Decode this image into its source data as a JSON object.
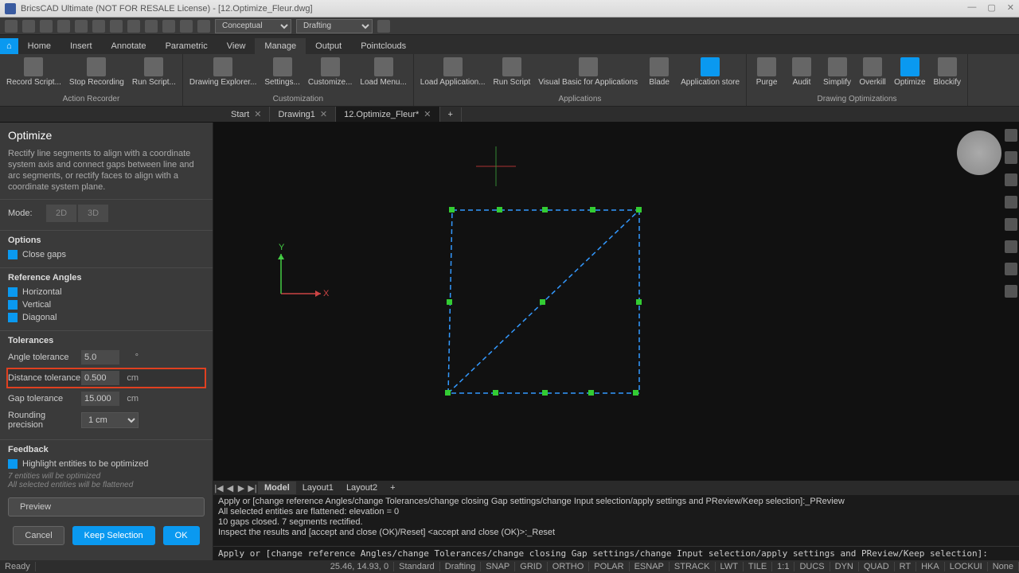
{
  "title": "BricsCAD Ultimate (NOT FOR RESALE License) - [12.Optimize_Fleur.dwg]",
  "qat": {
    "style": "Conceptual",
    "workspace": "Drafting"
  },
  "ribbon_tabs": [
    "Home",
    "Insert",
    "Annotate",
    "Parametric",
    "View",
    "Manage",
    "Output",
    "Pointclouds"
  ],
  "ribbon_active": "Manage",
  "ribbon": {
    "groups": [
      {
        "title": "Action Recorder",
        "items": [
          "Record Script...",
          "Stop Recording",
          "Run Script..."
        ]
      },
      {
        "title": "Customization",
        "items": [
          "Drawing Explorer...",
          "Settings...",
          "Customize...",
          "Load Menu..."
        ]
      },
      {
        "title": "Applications",
        "items": [
          "Load Application...",
          "Run Script",
          "Visual Basic for Applications",
          "Blade",
          "Application store"
        ]
      },
      {
        "title": "Drawing Optimizations",
        "items": [
          "Purge",
          "Audit",
          "Simplify",
          "Overkill",
          "Optimize",
          "Blockify"
        ]
      }
    ]
  },
  "doc_tabs": [
    {
      "label": "Start",
      "closable": true
    },
    {
      "label": "Drawing1",
      "closable": true
    },
    {
      "label": "12.Optimize_Fleur*",
      "closable": true,
      "active": true
    }
  ],
  "panel": {
    "title": "Optimize",
    "desc": "Rectify line segments to align with a coordinate system axis and connect gaps between line and arc segments, or rectify faces to align with a coordinate system plane.",
    "mode_label": "Mode:",
    "mode_2d": "2D",
    "mode_3d": "3D",
    "options_title": "Options",
    "close_gaps": "Close gaps",
    "ref_title": "Reference Angles",
    "ref_h": "Horizontal",
    "ref_v": "Vertical",
    "ref_d": "Diagonal",
    "tol_title": "Tolerances",
    "angle_lbl": "Angle tolerance",
    "angle_val": "5.0",
    "angle_unit": "°",
    "dist_lbl": "Distance tolerance",
    "dist_val": "0.500",
    "dist_unit": "cm",
    "gap_lbl": "Gap tolerance",
    "gap_val": "15.000",
    "gap_unit": "cm",
    "round_lbl": "Rounding precision",
    "round_val": "1 cm",
    "feedback_title": "Feedback",
    "highlight_lbl": "Highlight entities to be optimized",
    "hint1": "7 entities will be optimized",
    "hint2": "All selected entities will be flattened",
    "preview": "Preview",
    "cancel": "Cancel",
    "keep": "Keep Selection",
    "ok": "OK"
  },
  "layout_tabs": [
    "Model",
    "Layout1",
    "Layout2"
  ],
  "cmd_out": [
    "Apply or [change reference Angles/change Tolerances/change closing Gap settings/change Input selection/apply settings and PReview/Keep selection]:_PReview",
    "All selected entities are flattened: elevation = 0",
    "10 gaps closed. 7 segments rectified.",
    "Inspect the results and [accept and close (OK)/Reset] <accept and close (OK)>:_Reset"
  ],
  "cmd_prompt": "Apply or [change reference Angles/change Tolerances/change closing Gap settings/change Input selection/apply settings and PReview/Keep selection]:",
  "status": {
    "ready": "Ready",
    "coords": "25.46, 14.93, 0",
    "units": "Standard",
    "items": [
      "SNAP",
      "GRID",
      "ORTHO",
      "POLAR",
      "ESNAP",
      "STRACK",
      "LWT",
      "TILE",
      "1:1",
      "DUCS",
      "DYN",
      "QUAD",
      "RT",
      "HKA",
      "LOCKUI",
      "None"
    ],
    "drafting": "Drafting"
  }
}
